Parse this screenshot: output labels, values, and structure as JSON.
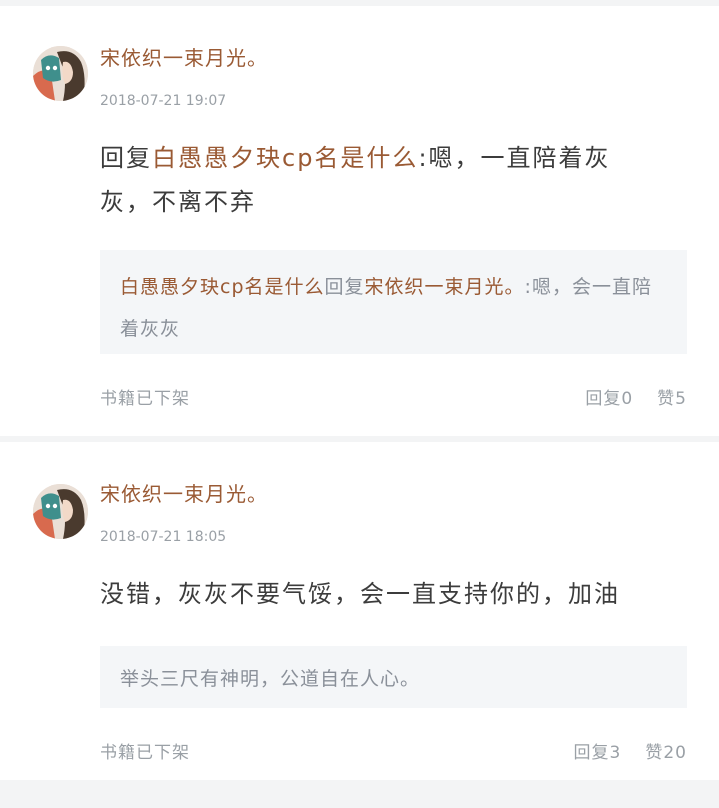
{
  "comments": [
    {
      "author": "宋依织一束月光。",
      "timestamp": "2018-07-21 19:07",
      "content_prefix": "回复",
      "content_reply_to": "白愚愚夕玦cp名是什么",
      "content_text": ":嗯，一直陪着灰灰，不离不弃",
      "quote_user": "白愚愚夕玦cp名是什么",
      "quote_reply_word": "回复",
      "quote_target": "宋依织一束月光。",
      "quote_text": ":嗯，会一直陪着灰灰",
      "book_status": "书籍已下架",
      "reply_label": "回复",
      "reply_count": "0",
      "like_label": "赞",
      "like_count": "5"
    },
    {
      "author": "宋依织一束月光。",
      "timestamp": "2018-07-21 18:05",
      "content_text": "没错，灰灰不要气馁，会一直支持你的，加油",
      "quote_text": "举头三尺有神明，公道自在人心。",
      "book_status": "书籍已下架",
      "reply_label": "回复",
      "reply_count": "3",
      "like_label": "赞",
      "like_count": "20"
    }
  ]
}
